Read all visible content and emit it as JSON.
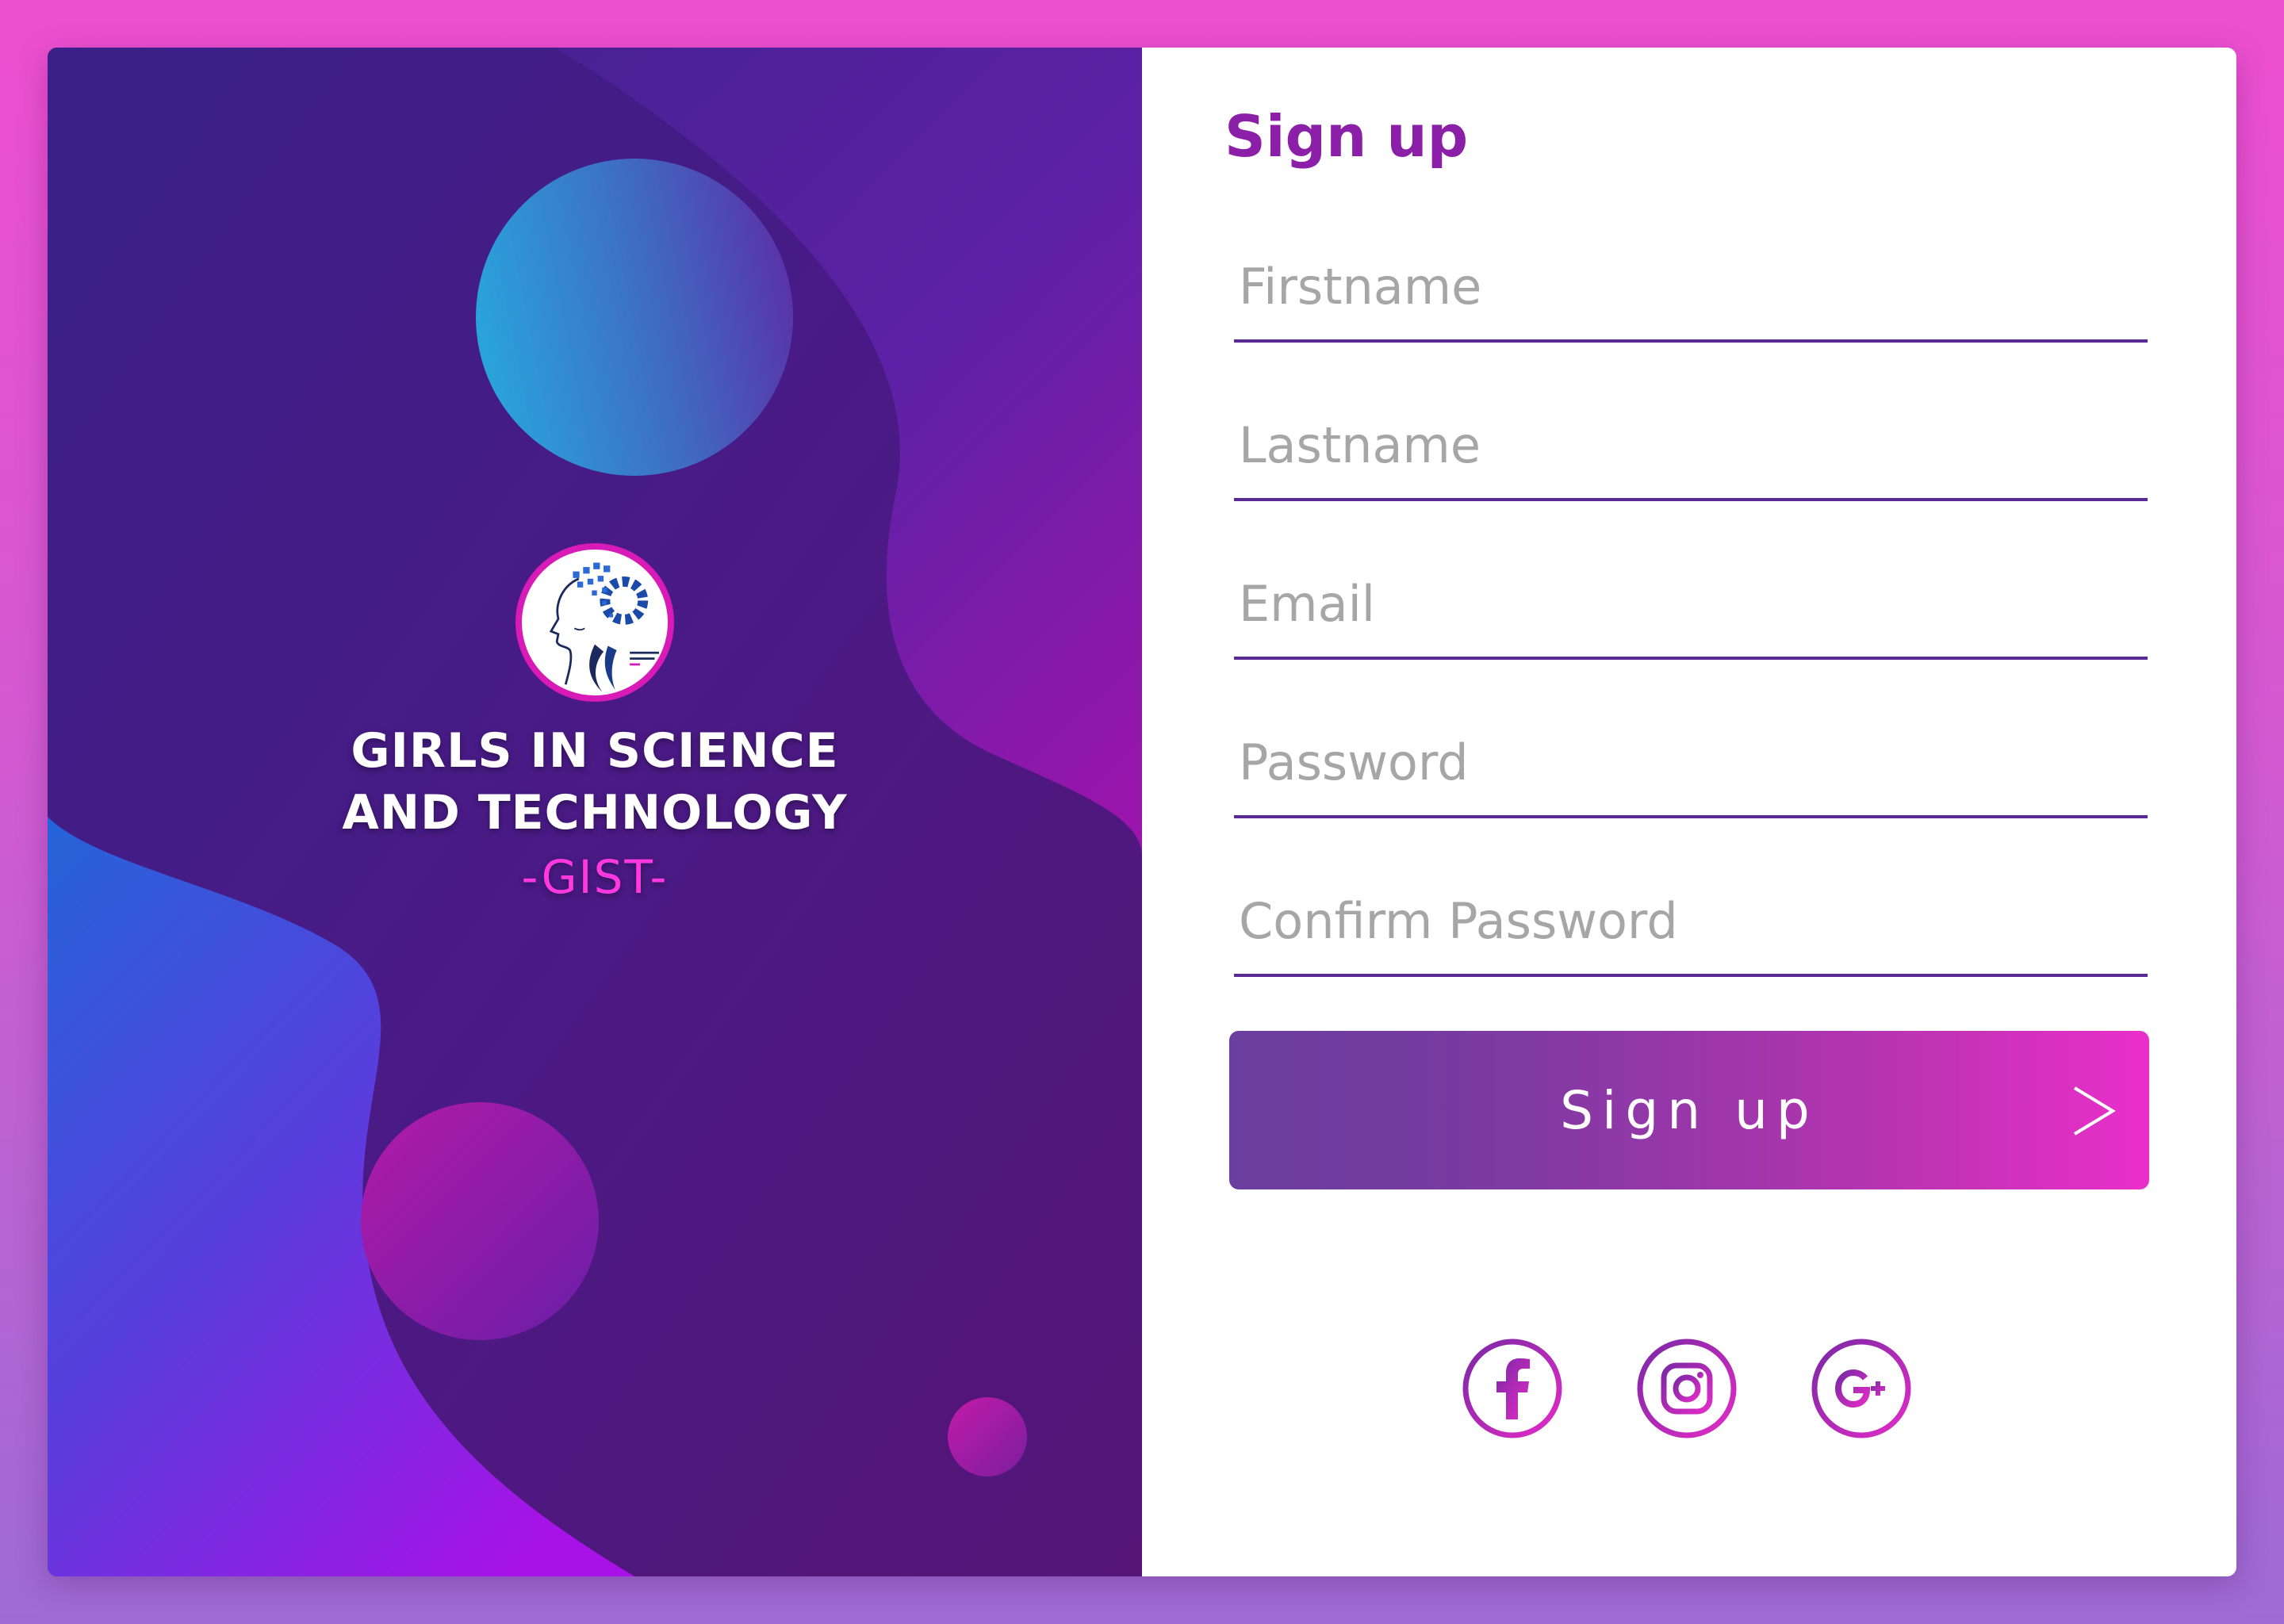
{
  "brand": {
    "line1": "GIRLS IN SCIENCE",
    "line2": "AND TECHNOLOGY",
    "short": "-GIST-"
  },
  "form": {
    "title": "Sign up",
    "fields": [
      {
        "name": "firstname",
        "placeholder": "Firstname",
        "value": ""
      },
      {
        "name": "lastname",
        "placeholder": "Lastname",
        "value": ""
      },
      {
        "name": "email",
        "placeholder": "Email",
        "value": ""
      },
      {
        "name": "password",
        "placeholder": "Password",
        "value": ""
      },
      {
        "name": "confirm_password",
        "placeholder": "Confirm Password",
        "value": ""
      }
    ],
    "submit_label": "Sign up",
    "submit_icon": "chevron-right-icon"
  },
  "social": [
    {
      "icon": "facebook-icon"
    },
    {
      "icon": "instagram-icon"
    },
    {
      "icon": "google-plus-icon"
    }
  ],
  "colors": {
    "accent": "#8b1fa8",
    "brand_pink": "#ff38e0",
    "underline": "#5b2a96"
  }
}
